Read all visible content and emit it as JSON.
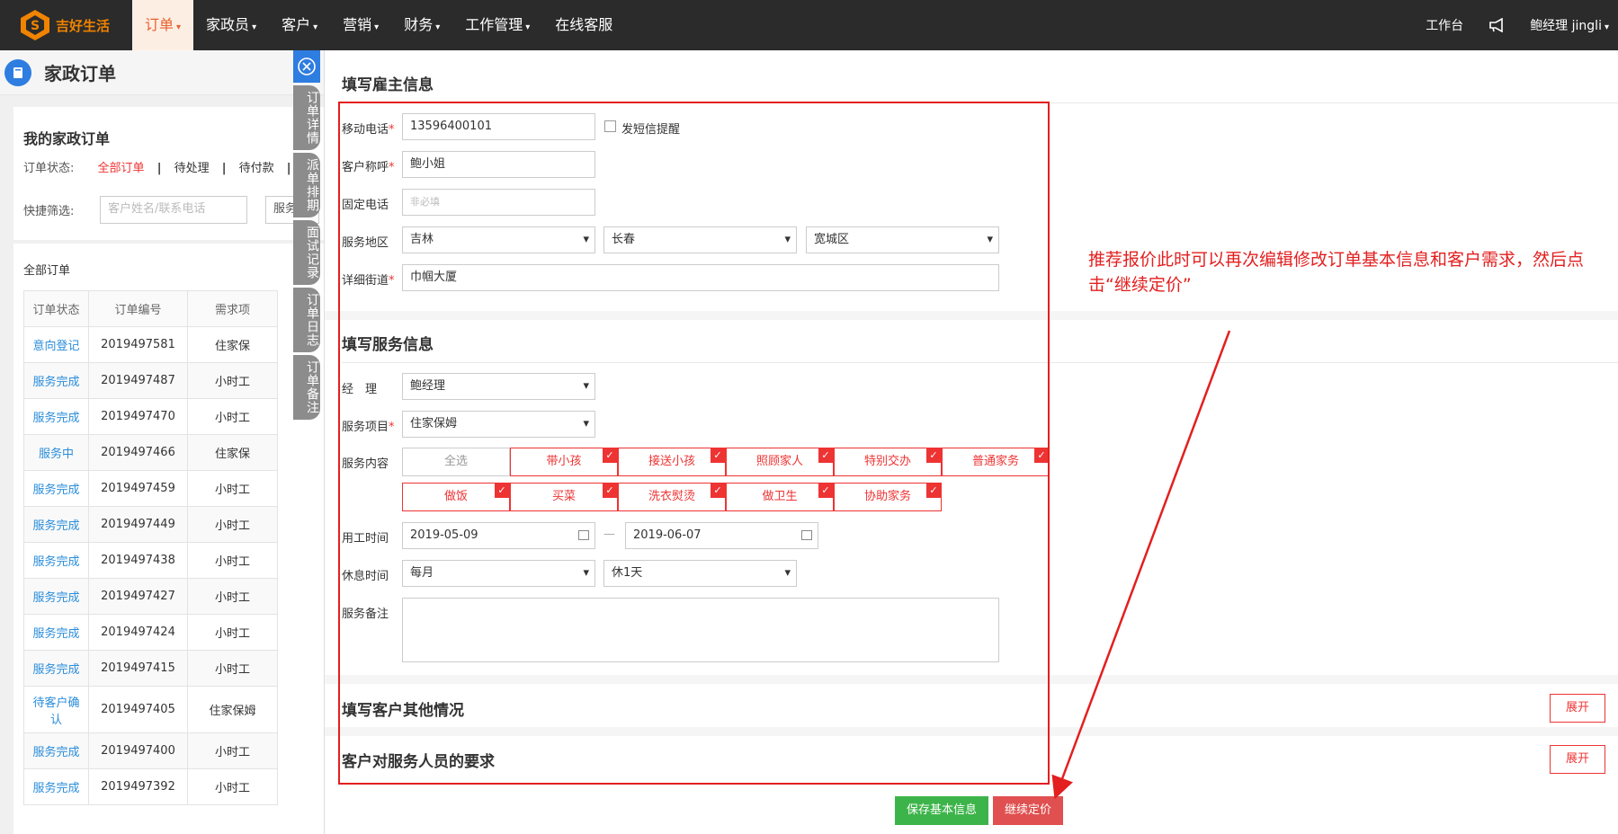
{
  "navbar": {
    "logo_text": "吉好生活",
    "menu": [
      {
        "label": "订单",
        "caret": true,
        "active": true
      },
      {
        "label": "家政员",
        "caret": true
      },
      {
        "label": "客户",
        "caret": true
      },
      {
        "label": "营销",
        "caret": true
      },
      {
        "label": "财务",
        "caret": true
      },
      {
        "label": "工作管理",
        "caret": true
      },
      {
        "label": "在线客服",
        "caret": false
      }
    ],
    "workbench": "工作台",
    "user": "鲍经理 jingli"
  },
  "left": {
    "page_title": "家政订单",
    "my_orders_title": "我的家政订单",
    "status_label": "订单状态:",
    "status_options": [
      "全部订单",
      "待处理",
      "待付款"
    ],
    "quick_filter_label": "快捷筛选:",
    "quick_filter_placeholder": "客户姓名/联系电话",
    "quick_filter_btn": "服务",
    "all_orders_title": "全部订单",
    "table": {
      "headers": [
        "订单状态",
        "订单编号",
        "需求项"
      ],
      "rows": [
        [
          "意向登记",
          "2019497581",
          "住家保"
        ],
        [
          "服务完成",
          "2019497487",
          "小时工"
        ],
        [
          "服务完成",
          "2019497470",
          "小时工"
        ],
        [
          "服务中",
          "2019497466",
          "住家保"
        ],
        [
          "服务完成",
          "2019497459",
          "小时工"
        ],
        [
          "服务完成",
          "2019497449",
          "小时工"
        ],
        [
          "服务完成",
          "2019497438",
          "小时工"
        ],
        [
          "服务完成",
          "2019497427",
          "小时工"
        ],
        [
          "服务完成",
          "2019497424",
          "小时工"
        ],
        [
          "服务完成",
          "2019497415",
          "小时工"
        ],
        [
          "待客户确认",
          "2019497405",
          "住家保姆"
        ],
        [
          "服务完成",
          "2019497400",
          "小时工"
        ],
        [
          "服务完成",
          "2019497392",
          "小时工"
        ]
      ]
    }
  },
  "vtabs": [
    "订单详情",
    "派单排期",
    "面试记录",
    "订单日志",
    "订单备注"
  ],
  "form": {
    "employer_title": "填写雇主信息",
    "mobile_label": "移动电话",
    "mobile_value": "13596400101",
    "sms_label": "发短信提醒",
    "name_label": "客户称呼",
    "name_value": "鲍小姐",
    "phone_label": "固定电话",
    "phone_placeholder": "非必填",
    "region_label": "服务地区",
    "province": "吉林",
    "city": "长春",
    "district": "宽城区",
    "street_label": "详细街道",
    "street_value": "巾帼大厦",
    "service_title": "填写服务信息",
    "manager_label": "经　理",
    "manager_value": "鲍经理",
    "item_label": "服务项目",
    "item_value": "住家保姆",
    "content_label": "服务内容",
    "select_all": "全选",
    "contents_row1": [
      "带小孩",
      "接送小孩",
      "照顾家人",
      "特别交办",
      "普通家务"
    ],
    "contents_row2": [
      "做饭",
      "买菜",
      "洗衣熨烫",
      "做卫生",
      "协助家务"
    ],
    "time_label": "用工时间",
    "date_start": "2019-05-09",
    "date_sep": "—",
    "date_end": "2019-06-07",
    "rest_label": "休息时间",
    "rest_period": "每月",
    "rest_days": "休1天",
    "note_label": "服务备注",
    "other_title": "填写客户其他情况",
    "req_title": "客户对服务人员的要求",
    "expand": "展开",
    "save_btn": "保存基本信息",
    "next_btn": "继续定价"
  },
  "annotation": "推荐报价此时可以再次编辑修改订单基本信息和客户需求，然后点击“继续定价”",
  "colors": {
    "accent_red": "#e31f1f",
    "nav_bg": "#2b2b2b",
    "link_blue": "#2a8ddb",
    "save_green": "#3db44a",
    "next_red": "#e05050"
  }
}
